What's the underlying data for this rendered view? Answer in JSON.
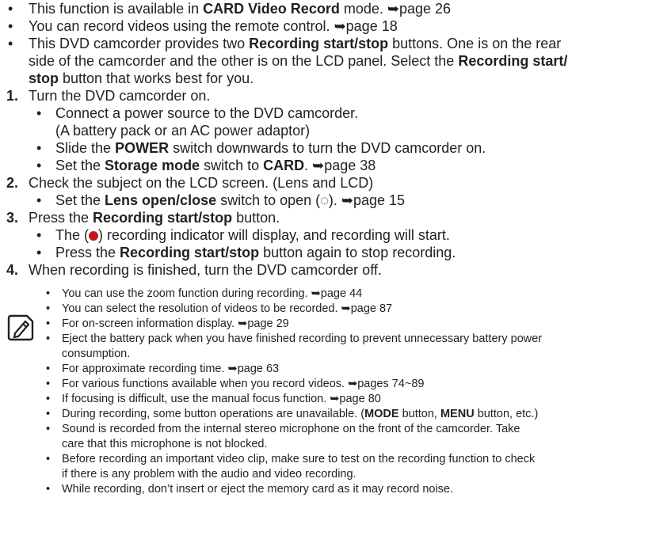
{
  "arrow": "➥",
  "top_bullets": [
    {
      "pre": "This function is available in ",
      "bold": "CARD Video Record",
      "post": " mode. ",
      "ref": "page 26"
    },
    {
      "pre": "You can record videos using the remote control. ",
      "ref": "page 18"
    },
    {
      "l1_pre": "This DVD camcorder provides two ",
      "l1_bold": "Recording start/stop",
      "l1_post": " buttons. One is on the rear",
      "l2": "side of the camcorder and the other is on the LCD panel. Select the ",
      "l2_bold": "Recording start/",
      "l3_bold": "stop",
      "l3_post": " button that works best for you."
    }
  ],
  "steps": [
    {
      "num": "1.",
      "text": "Turn the DVD camcorder on.",
      "subs": [
        {
          "l1": "Connect a power source to the DVD camcorder.",
          "l2": "(A battery pack or an AC power adaptor)"
        },
        {
          "pre": "Slide the ",
          "bold": "POWER",
          "post": " switch downwards to turn the DVD camcorder on."
        },
        {
          "pre": "Set the ",
          "bold": "Storage mode",
          "mid": " switch to ",
          "bold2": "CARD",
          "post": ". ",
          "ref": "page 38"
        }
      ]
    },
    {
      "num": "2.",
      "text": "Check the subject on the LCD screen. (Lens and LCD)",
      "subs": [
        {
          "pre": "Set the ",
          "bold": "Lens open/close",
          "post": " switch to open (◌). ",
          "ref": "page 15"
        }
      ]
    },
    {
      "num": "3.",
      "pre": "Press the ",
      "bold": "Recording start/stop",
      "post": " button.",
      "subs": [
        {
          "pre": "The (",
          "post": ") recording indicator will display, and recording will start."
        },
        {
          "pre": "Press the ",
          "bold": "Recording start/stop",
          "post": " button again to stop recording."
        }
      ]
    },
    {
      "num": "4.",
      "text": "When recording is finished, turn the DVD camcorder off."
    }
  ],
  "notes": [
    {
      "text": "You can use the zoom function during recording. ",
      "ref": "page 44"
    },
    {
      "text": "You can select the resolution of videos to be recorded. ",
      "ref": "page 87"
    },
    {
      "text": "For on-screen information display. ",
      "ref": "page 29"
    },
    {
      "l1": "Eject the battery pack when you have finished recording to prevent unnecessary battery power",
      "l2": "consumption."
    },
    {
      "text": "For approximate recording time. ",
      "ref": "page 63"
    },
    {
      "text": "For various functions available when you record videos. ",
      "ref": "pages 74~89"
    },
    {
      "text": "If focusing is difficult, use the manual focus function. ",
      "ref": "page 80"
    },
    {
      "pre": "During recording, some button operations are unavailable. (",
      "bold": "MODE",
      "mid": " button, ",
      "bold2": "MENU",
      "post": " button, etc.)"
    },
    {
      "l1": "Sound is recorded from the internal stereo microphone on the front of the camcorder. Take",
      "l2": "care that this microphone is not blocked."
    },
    {
      "l1": "Before recording an important video clip, make sure to test on the recording function to check",
      "l2": "if there is any problem with the audio and video recording."
    },
    {
      "text": "While recording, don’t insert or eject the memory card as it may record noise."
    }
  ],
  "colors": {
    "text": "#231f20",
    "record_dot": "#c8161d"
  },
  "icons": {
    "note": "note-pencil-icon",
    "record": "record-dot-icon",
    "lens": "lens-open-icon"
  }
}
